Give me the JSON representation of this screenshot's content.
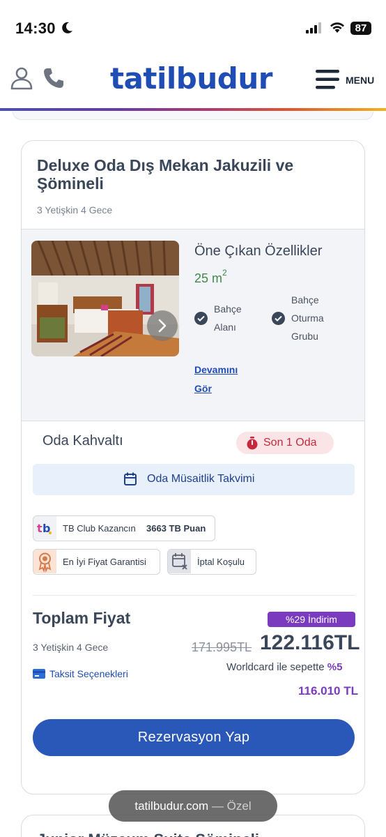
{
  "status_bar": {
    "time": "14:30",
    "battery": "87"
  },
  "header": {
    "logo": "tatilbudur",
    "menu_label": "MENU"
  },
  "room": {
    "title": "Deluxe Oda Dış Mekan Jakuzili ve Şömineli",
    "subtitle": "3 Yetişkin 4 Gece",
    "features_title": "Öne Çıkan Özellikler",
    "area_value": "25 m",
    "area_unit_sup": "2",
    "features": [
      {
        "label": "Bahçe Alanı"
      },
      {
        "label": "Bahçe Oturma Grubu"
      }
    ],
    "more_link": "Devamını Gör"
  },
  "board": {
    "label": "Oda Kahvaltı",
    "stock_badge": "Son 1 Oda"
  },
  "calendar_button": "Oda Müsaitlik Takvimi",
  "chips": {
    "club_label": "TB Club Kazancın",
    "club_points": "3663 TB Puan",
    "price_guarantee": "En İyi Fiyat Garantisi",
    "cancellation": "İptal Koşulu"
  },
  "pricing": {
    "total_label": "Toplam Fiyat",
    "discount_badge": "%29 İndirim",
    "subtitle": "3 Yetişkin 4 Gece",
    "old_price": "171.995TL",
    "new_price": "122.116TL",
    "installment_link": "Taksit Seçenekleri",
    "worldcard_text": "Worldcard ile sepette",
    "worldcard_rate": "%5",
    "worldcard_price": "116.010 TL"
  },
  "reserve_button": "Rezervasyon Yap",
  "next_card_title": "Junior Müzeum Suite Şömineli",
  "browser": {
    "domain": "tatilbudur.com",
    "separator": "—",
    "mode": "Özel"
  },
  "colors": {
    "brand_blue": "#1f4db3",
    "button_blue": "#2a58b8",
    "purple": "#7b3bbf",
    "alert_red": "#c8283c",
    "area_green": "#3d8a4a"
  }
}
